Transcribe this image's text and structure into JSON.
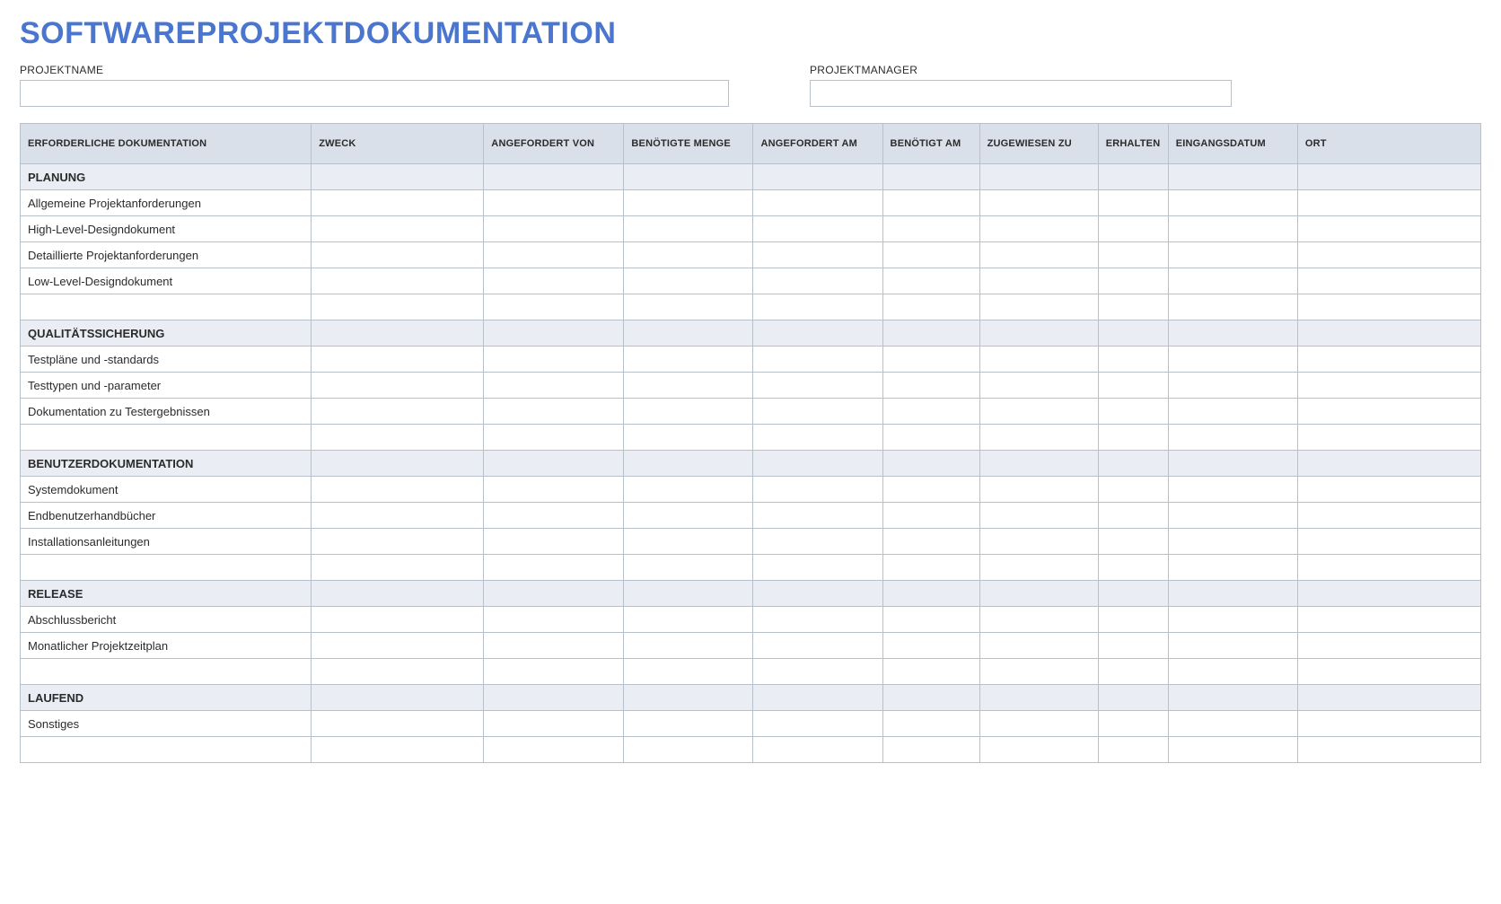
{
  "title": "SOFTWAREPROJEKTDOKUMENTATION",
  "fields": {
    "projectname_label": "PROJEKTNAME",
    "projectname_value": "",
    "projectmanager_label": "PROJEKTMANAGER",
    "projectmanager_value": ""
  },
  "columns": [
    "ERFORDERLICHE DOKUMENTATION",
    "ZWECK",
    "ANGEFORDERT VON",
    "BENÖTIGTE MENGE",
    "ANGEFORDERT AM",
    "BENÖTIGT AM",
    "ZUGEWIESEN ZU",
    "ERHALTEN",
    "EINGANGSDATUM",
    "ORT"
  ],
  "rows": [
    {
      "type": "section",
      "label": "PLANUNG"
    },
    {
      "type": "item",
      "label": "Allgemeine Projektanforderungen"
    },
    {
      "type": "item",
      "label": "High-Level-Designdokument"
    },
    {
      "type": "item",
      "label": "Detaillierte Projektanforderungen"
    },
    {
      "type": "item",
      "label": "Low-Level-Designdokument"
    },
    {
      "type": "blank",
      "label": ""
    },
    {
      "type": "section",
      "label": "QUALITÄTSSICHERUNG"
    },
    {
      "type": "item",
      "label": "Testpläne und -standards"
    },
    {
      "type": "item",
      "label": "Testtypen und -parameter"
    },
    {
      "type": "item",
      "label": "Dokumentation zu Testergebnissen"
    },
    {
      "type": "blank",
      "label": ""
    },
    {
      "type": "section",
      "label": "BENUTZERDOKUMENTATION"
    },
    {
      "type": "item",
      "label": "Systemdokument"
    },
    {
      "type": "item",
      "label": "Endbenutzerhandbücher"
    },
    {
      "type": "item",
      "label": "Installationsanleitungen"
    },
    {
      "type": "blank",
      "label": ""
    },
    {
      "type": "section",
      "label": "RELEASE"
    },
    {
      "type": "item",
      "label": "Abschlussbericht"
    },
    {
      "type": "item",
      "label": "Monatlicher Projektzeitplan"
    },
    {
      "type": "blank",
      "label": ""
    },
    {
      "type": "section",
      "label": "LAUFEND"
    },
    {
      "type": "item",
      "label": "Sonstiges"
    },
    {
      "type": "blank",
      "label": ""
    }
  ]
}
